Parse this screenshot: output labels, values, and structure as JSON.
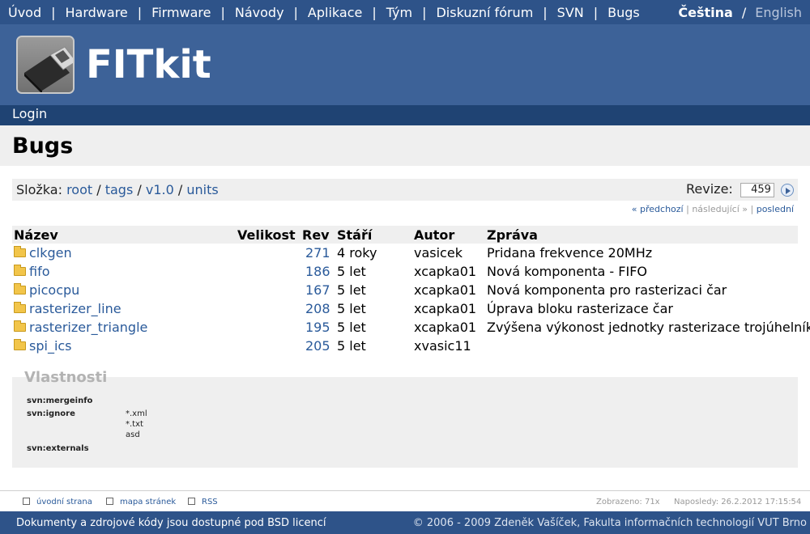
{
  "nav": {
    "items": [
      "Úvod",
      "Hardware",
      "Firmware",
      "Návody",
      "Aplikace",
      "Tým",
      "Diskuzní fórum",
      "SVN",
      "Bugs"
    ],
    "separator": "|",
    "lang_active": "Čeština",
    "lang_separator": "/",
    "lang_other": "English"
  },
  "banner": {
    "title": "FITkit"
  },
  "login": "Login",
  "page_title": "Bugs",
  "folder": {
    "label": "Složka:",
    "crumbs": [
      "root",
      "tags",
      "v1.0",
      "units"
    ],
    "crumb_separator": "/",
    "revision_label": "Revize:",
    "revision_value": "459"
  },
  "pager": {
    "prev": "« předchozí",
    "next": "následující »",
    "last": "poslední",
    "separator": "|"
  },
  "table": {
    "headers": {
      "name": "Název",
      "size": "Velikost",
      "rev": "Rev",
      "age": "Stáří",
      "author": "Autor",
      "message": "Zpráva"
    },
    "rows": [
      {
        "name": "clkgen",
        "rev": "271",
        "age": "4 roky",
        "author": "vasicek",
        "message": "Pridana frekvence 20MHz"
      },
      {
        "name": "fifo",
        "rev": "186",
        "age": "5 let",
        "author": "xcapka01",
        "message": "Nová komponenta - FIFO"
      },
      {
        "name": "picocpu",
        "rev": "167",
        "age": "5 let",
        "author": "xcapka01",
        "message": "Nová komponenta pro rasterizaci čar"
      },
      {
        "name": "rasterizer_line",
        "rev": "208",
        "age": "5 let",
        "author": "xcapka01",
        "message": "Úprava bloku rasterizace čar"
      },
      {
        "name": "rasterizer_triangle",
        "rev": "195",
        "age": "5 let",
        "author": "xcapka01",
        "message": "Zvýšena výkonost jednotky rasterizace trojúhelníka"
      },
      {
        "name": "spi_ics",
        "rev": "205",
        "age": "5 let",
        "author": "xvasic11",
        "message": ""
      }
    ]
  },
  "properties": {
    "title": "Vlastnosti",
    "mergeinfo_key": "svn:mergeinfo",
    "ignore_key": "svn:ignore",
    "ignore_values": [
      "*.xml",
      "*.txt",
      "asd"
    ],
    "externals_key": "svn:externals"
  },
  "footer": {
    "home": "úvodní strana",
    "sitemap": "mapa stránek",
    "rss": "RSS",
    "views": "Zobrazeno: 71x",
    "last_modified": "Naposledy: 26.2.2012 17:15:54",
    "license": "Dokumenty a zdrojové kódy jsou dostupné pod BSD licencí",
    "copyright": "© 2006 - 2009 Zdeněk Vašíček, Fakulta informačních technologií VUT Brno"
  },
  "colors": {
    "nav_bg": "#2e5389",
    "banner_bg": "#3d6298",
    "login_bg": "#1f4373",
    "link": "#2a5a9a",
    "band_bg": "#efefef"
  }
}
